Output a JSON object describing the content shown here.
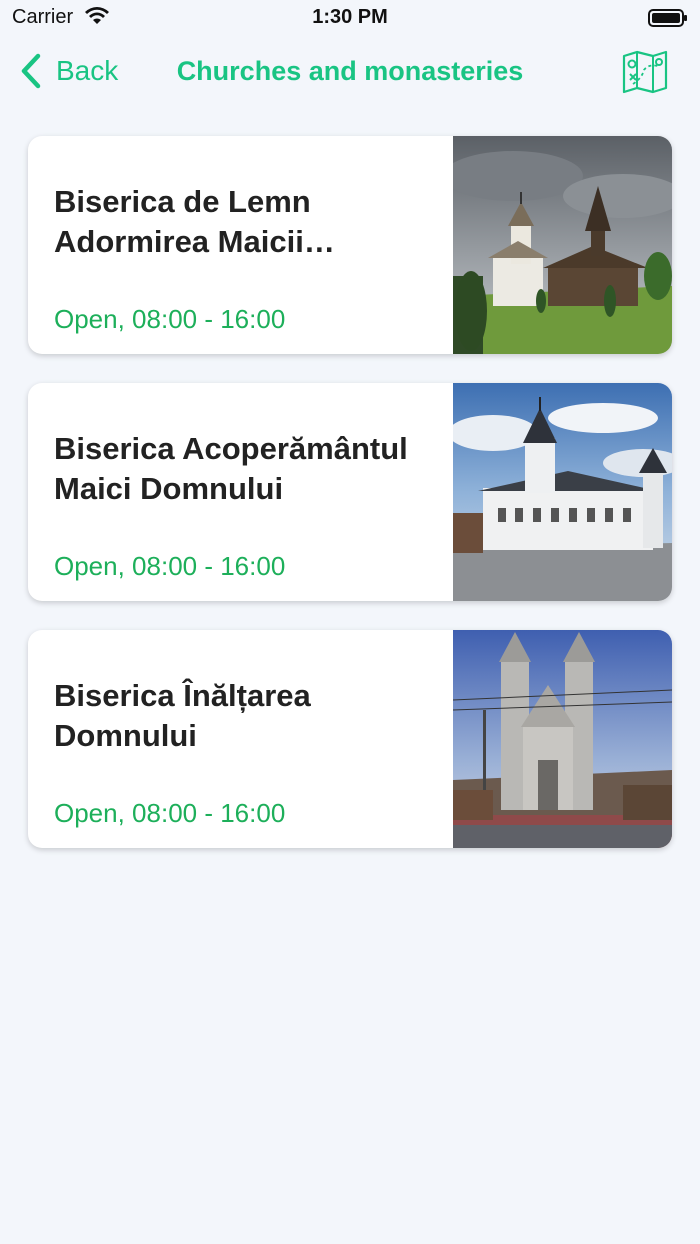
{
  "status_bar": {
    "carrier": "Carrier",
    "time": "1:30 PM"
  },
  "nav": {
    "back_label": "Back",
    "title": "Churches and monasteries",
    "map_icon": "map-icon",
    "accent_color": "#19c483"
  },
  "churches": [
    {
      "name": "Biserica de Lemn Adormirea Maicii Domnului",
      "hours": "Open, 08:00 - 16:00",
      "photo": "church-photo"
    },
    {
      "name": "Biserica Acoperământul Maici Domnului",
      "hours": "Open, 08:00 - 16:00",
      "photo": "church-photo"
    },
    {
      "name": "Biserica Înălțarea Domnului",
      "hours": "Open, 08:00 - 16:00",
      "photo": "church-photo"
    }
  ],
  "colors": {
    "background": "#f3f6fb",
    "open_status": "#1daf5a"
  }
}
